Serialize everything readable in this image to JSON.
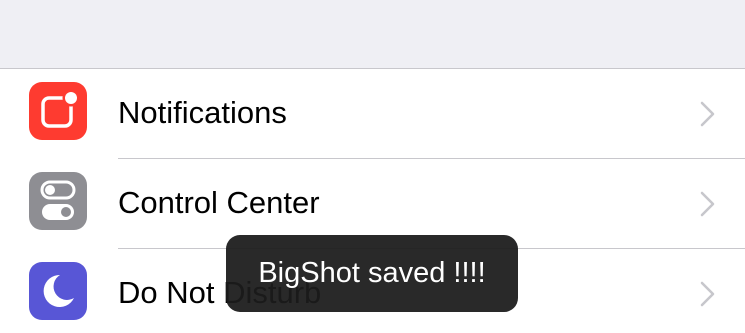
{
  "settings": {
    "items": [
      {
        "label": "Notifications",
        "icon": "notifications-icon",
        "icon_color": "#fe3b30"
      },
      {
        "label": "Control Center",
        "icon": "control-center-icon",
        "icon_color": "#8e8e93"
      },
      {
        "label": "Do Not Disturb",
        "icon": "moon-icon",
        "icon_color": "#5856d6"
      }
    ]
  },
  "toast": {
    "message": "BigShot saved !!!!"
  },
  "colors": {
    "background": "#efeff4",
    "separator": "#c8c7cc",
    "chevron": "#c7c7cc"
  }
}
